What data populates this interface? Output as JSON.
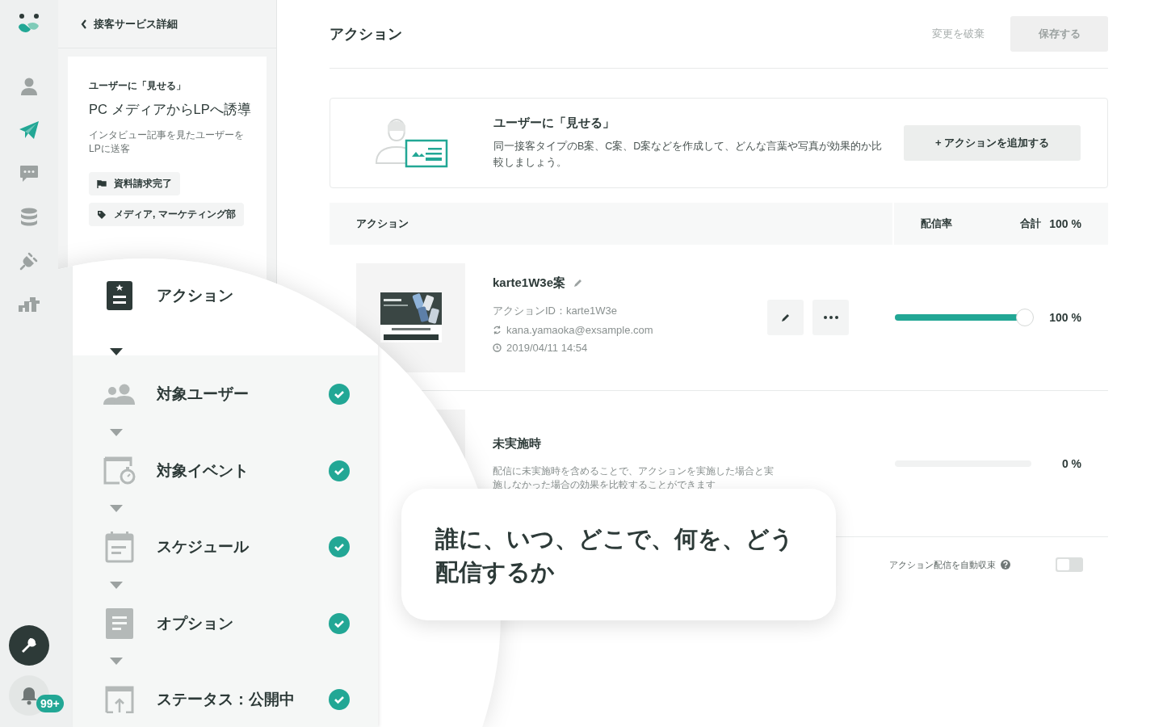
{
  "nav": [
    {
      "selected": false
    },
    {
      "selected": true
    },
    {
      "selected": false
    },
    {
      "selected": false
    },
    {
      "selected": false
    },
    {
      "selected": false
    }
  ],
  "notifications": {
    "badge": "99+"
  },
  "breadcrumb": {
    "back_label": "接客サービス詳細"
  },
  "campaign": {
    "type_label": "ユーザーに「見せる」",
    "title": "PC メディアからLPへ誘導",
    "description": "インタビュー記事を見たユーザーをLPに送客",
    "tags": [
      {
        "kind": "flag",
        "label": "資料請求完了"
      },
      {
        "kind": "tag",
        "label": "メディア, マーケティング部"
      }
    ]
  },
  "header": {
    "title": "アクション",
    "discard": {
      "label": "変更を破棄",
      "disabled": true
    },
    "save": {
      "label": "保存する",
      "disabled": true
    }
  },
  "info": {
    "title": "ユーザーに「見せる」",
    "description": "同一接客タイプのB案、C案、D案などを作成して、どんな言葉や写真が効果的か比較しましょう。",
    "add_button": "+ アクションを追加する"
  },
  "table": {
    "columns": [
      "アクション",
      "配信率"
    ],
    "total_label": "合計",
    "total": "100 %"
  },
  "rows": [
    {
      "kind": "variant",
      "name": "karte1W3e案",
      "action_id": "アクションID：karte1W3e",
      "author": "kana.yamaoka@exsample.com",
      "date": "2019/04/11 14:54",
      "level": 1,
      "reading": "100 %"
    },
    {
      "kind": "control",
      "name": "未実施時",
      "description": "配信に未実施時を含めることで、アクションを実施した場合と実施しなかった場合の効果を比較することができます",
      "level": 0,
      "reading": "0 %"
    }
  ],
  "auto_converge": {
    "label": "アクション配信を自動収束",
    "on": false
  },
  "steps": [
    {
      "label": "アクション",
      "selected": true
    },
    {
      "label": "対象ユーザー",
      "selected": false,
      "checked": true
    },
    {
      "label": "対象イベント",
      "selected": false,
      "checked": true
    },
    {
      "label": "スケジュール",
      "selected": false,
      "checked": true
    },
    {
      "label": "オプション",
      "selected": false,
      "checked": true
    },
    {
      "label": "ステータス：公開中",
      "selected": false,
      "checked": true
    }
  ],
  "callout": {
    "text": "誰に、いつ、どこで、何を、どう配信するか"
  }
}
